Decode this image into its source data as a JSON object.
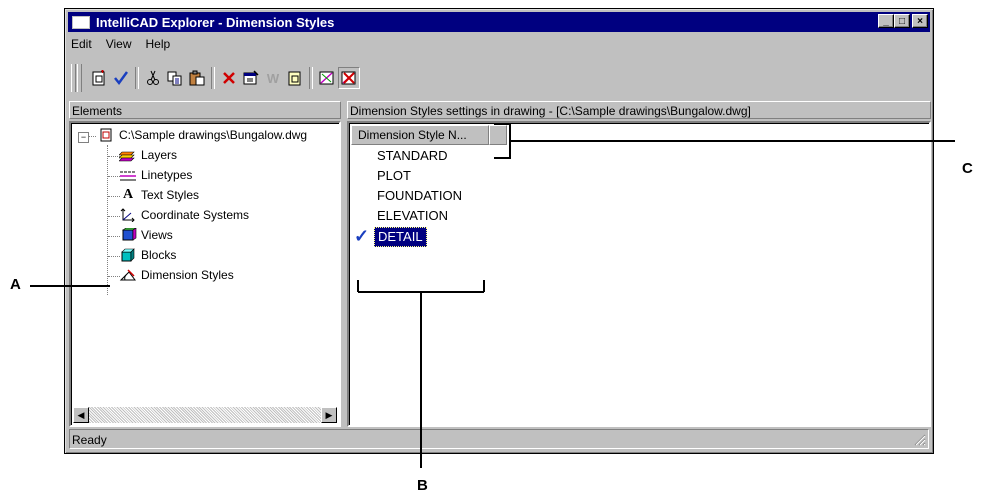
{
  "window": {
    "title": "IntelliCAD Explorer - Dimension Styles",
    "controls": {
      "minimize": "_",
      "maximize": "□",
      "close": "×"
    }
  },
  "menu": [
    "Edit",
    "View",
    "Help"
  ],
  "toolbar": {
    "icons": [
      "new-item-icon",
      "set-current-check-icon",
      "cut-icon",
      "copy-icon",
      "paste-icon",
      "delete-icon",
      "properties-icon",
      "w-icon",
      "purge-icon",
      "show-elements-icon",
      "hide-elements-icon"
    ],
    "w_label": "W"
  },
  "left_panel": {
    "header": "Elements",
    "root": "C:\\Sample drawings\\Bungalow.dwg",
    "items": [
      "Layers",
      "Linetypes",
      "Text Styles",
      "Coordinate Systems",
      "Views",
      "Blocks",
      "Dimension Styles"
    ],
    "text_style_glyph": "A"
  },
  "right_panel": {
    "header": "Dimension Styles settings in drawing - [C:\\Sample drawings\\Bungalow.dwg]",
    "column": "Dimension Style N...",
    "styles": [
      "STANDARD",
      "PLOT",
      "FOUNDATION",
      "ELEVATION",
      "DETAIL"
    ],
    "current_style": "DETAIL",
    "check_glyph": "✓"
  },
  "status": "Ready",
  "callouts": {
    "a": "A",
    "b": "B",
    "c": "C"
  },
  "colors": {
    "titlebar": "#000080",
    "selection": "#000080",
    "check": "#1a3fbf"
  }
}
